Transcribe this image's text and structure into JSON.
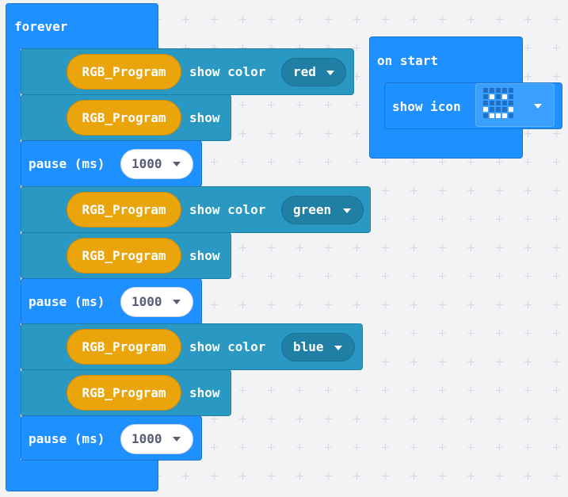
{
  "forever": {
    "label": "forever",
    "rows": [
      {
        "type": "rgb",
        "component": "RGB_Program",
        "action": "show color",
        "value": "red"
      },
      {
        "type": "rgb",
        "component": "RGB_Program",
        "action": "show"
      },
      {
        "type": "pause",
        "label": "pause (ms)",
        "value": "1000"
      },
      {
        "type": "rgb",
        "component": "RGB_Program",
        "action": "show color",
        "value": "green"
      },
      {
        "type": "rgb",
        "component": "RGB_Program",
        "action": "show"
      },
      {
        "type": "pause",
        "label": "pause (ms)",
        "value": "1000"
      },
      {
        "type": "rgb",
        "component": "RGB_Program",
        "action": "show color",
        "value": "blue"
      },
      {
        "type": "rgb",
        "component": "RGB_Program",
        "action": "show"
      },
      {
        "type": "pause",
        "label": "pause (ms)",
        "value": "1000"
      }
    ]
  },
  "on_start": {
    "label": "on start",
    "show_icon_label": "show icon",
    "icon_matrix": [
      [
        0,
        0,
        0,
        0,
        0
      ],
      [
        0,
        1,
        0,
        1,
        0
      ],
      [
        0,
        0,
        0,
        0,
        0
      ],
      [
        1,
        0,
        0,
        0,
        1
      ],
      [
        0,
        1,
        1,
        1,
        0
      ]
    ]
  },
  "colors": {
    "loops_blue": "#1e90ff",
    "rgb_teal": "#2999c4",
    "rgb_pill": "#eaa40c",
    "canvas_bg": "#f2f3f5"
  }
}
